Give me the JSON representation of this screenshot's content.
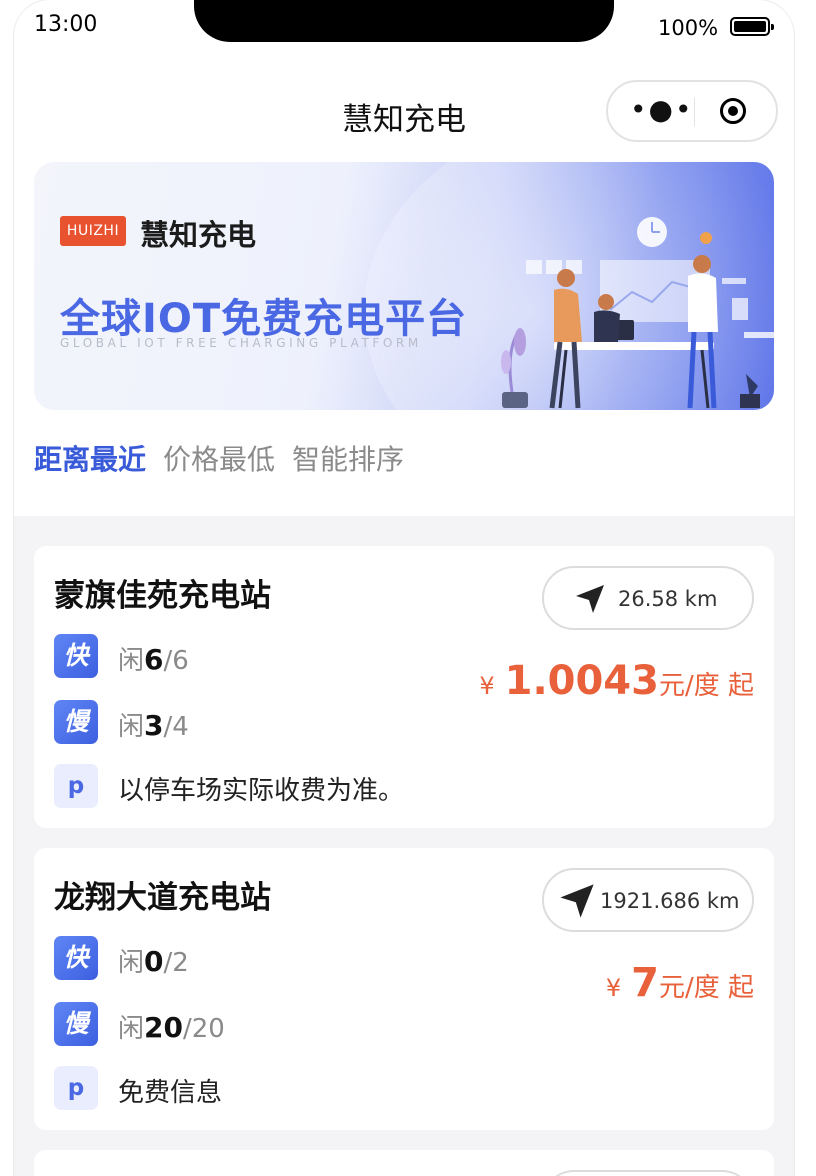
{
  "status_bar": {
    "time": "13:00",
    "battery": "100%"
  },
  "nav": {
    "title": "慧知充电"
  },
  "banner": {
    "brand_badge": "HUIZHI",
    "brand_name": "慧知充电",
    "slogan": "全球IOT免费充电平台",
    "slogan_en": "GLOBAL IOT FREE CHARGING PLATFORM"
  },
  "sort_tabs": [
    {
      "label": "距离最近",
      "active": true
    },
    {
      "label": "价格最低",
      "active": false
    },
    {
      "label": "智能排序",
      "active": false
    }
  ],
  "stations": [
    {
      "name": "蒙旗佳苑充电站",
      "distance": "26.58 km",
      "fast": {
        "tag": "快",
        "prefix": "闲",
        "free": "6",
        "total": "/6"
      },
      "slow": {
        "tag": "慢",
        "prefix": "闲",
        "free": "3",
        "total": "/4"
      },
      "parking": {
        "tag": "p",
        "text": "以停车场实际收费为准。"
      },
      "price": {
        "currency": "¥",
        "value": "1.0043",
        "unit": "元/度 起"
      }
    },
    {
      "name": "龙翔大道充电站",
      "distance": "1921.686 km",
      "fast": {
        "tag": "快",
        "prefix": "闲",
        "free": "0",
        "total": "/2"
      },
      "slow": {
        "tag": "慢",
        "prefix": "闲",
        "free": "20",
        "total": "/20"
      },
      "parking": {
        "tag": "p",
        "text": "免费信息"
      },
      "price": {
        "currency": "¥",
        "value": "7",
        "unit": "元/度 起"
      }
    }
  ],
  "colors": {
    "accent": "#3a5bd9",
    "price": "#e8613b",
    "badge": "#e8522f"
  }
}
